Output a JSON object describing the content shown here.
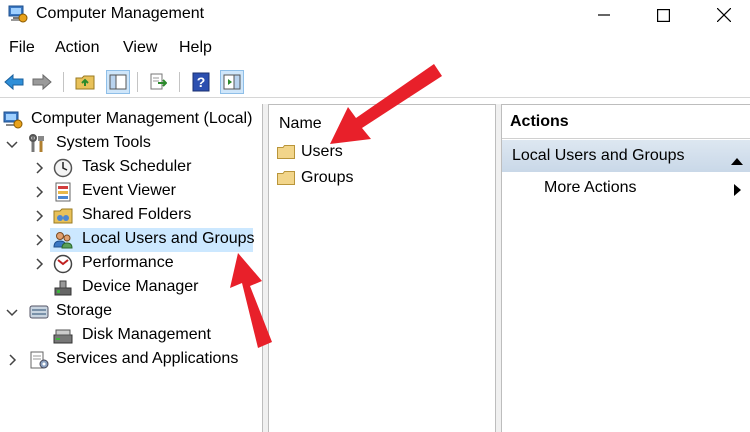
{
  "window": {
    "title": "Computer Management",
    "controls": [
      "minimize",
      "maximize",
      "close"
    ]
  },
  "menu": [
    "File",
    "Action",
    "View",
    "Help"
  ],
  "toolbar": {
    "buttons": [
      "back-arrow-icon",
      "forward-arrow-icon",
      "up-folder-icon",
      "show-hide-console-tree-icon",
      "export-list-icon",
      "help-icon",
      "show-hide-action-pane-icon"
    ]
  },
  "tree": {
    "root": "Computer Management (Local)",
    "system_tools": "System Tools",
    "task_scheduler": "Task Scheduler",
    "event_viewer": "Event Viewer",
    "shared_folders": "Shared Folders",
    "local_users_groups": "Local Users and Groups",
    "performance": "Performance",
    "device_manager": "Device Manager",
    "storage": "Storage",
    "disk_management": "Disk Management",
    "services_apps": "Services and Applications"
  },
  "list": {
    "column": "Name",
    "items": [
      "Users",
      "Groups"
    ]
  },
  "actions": {
    "header": "Actions",
    "section": "Local Users and Groups",
    "item": "More Actions"
  },
  "colors": {
    "selection": "#cce8ff",
    "annotation_arrow": "#e8202a",
    "action_section": "#c9d8e8"
  }
}
